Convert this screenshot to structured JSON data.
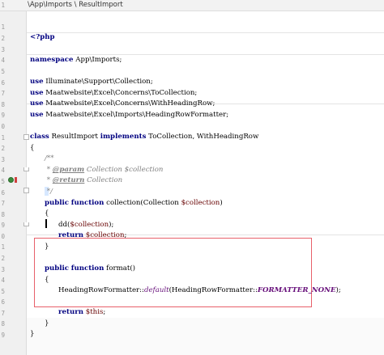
{
  "breadcrumb": {
    "text": "\\App\\Imports  \\  ResultImport"
  },
  "line_numbers": [
    "1",
    "2",
    "3",
    "4",
    "5",
    "6",
    "7",
    "8",
    "9",
    "0",
    "1",
    "2",
    "3",
    "4",
    "5",
    "6",
    "7",
    "8",
    "9",
    "0",
    "1",
    "2",
    "3",
    "4",
    "5",
    "6",
    "7",
    "8",
    "9"
  ],
  "code": {
    "l1": "<?php",
    "l3_kw": "namespace",
    "l3_rest": " App\\Imports;",
    "use_kw": "use",
    "use1": " Illuminate\\Support\\Collection;",
    "use2": " Maatwebsite\\Excel\\Concerns\\ToCollection;",
    "use3": " Maatwebsite\\Excel\\Concerns\\WithHeadingRow;",
    "use4": " Maatwebsite\\Excel\\Imports\\HeadingRowFormatter;",
    "class_kw": "class",
    "class_name": " ResultImport ",
    "implements_kw": "implements",
    "class_rest": " ToCollection, WithHeadingRow",
    "open_brace": "{",
    "close_brace": "}",
    "doc_open": "/**",
    "doc_star": " * ",
    "param_tag": "@param",
    "param_rest": " Collection $collection",
    "return_tag": "@return",
    "return_rest": " Collection",
    "doc_close": " */",
    "public_kw": "public",
    "function_kw": "function",
    "collection_sig": " collection(Collection ",
    "collection_var": "$collection",
    "close_paren": ")",
    "dd_call": "dd(",
    "dd_close": ");",
    "return_kw": "return",
    "semicolon": ";",
    "format_sig": " format()",
    "hrf": "HeadingRowFormatter::",
    "default_method": "default",
    "hrf2": "(HeadingRowFormatter::",
    "formatter_const": "FORMATTER_NONE",
    "hrf_close": ");",
    "this_var": "$this"
  }
}
